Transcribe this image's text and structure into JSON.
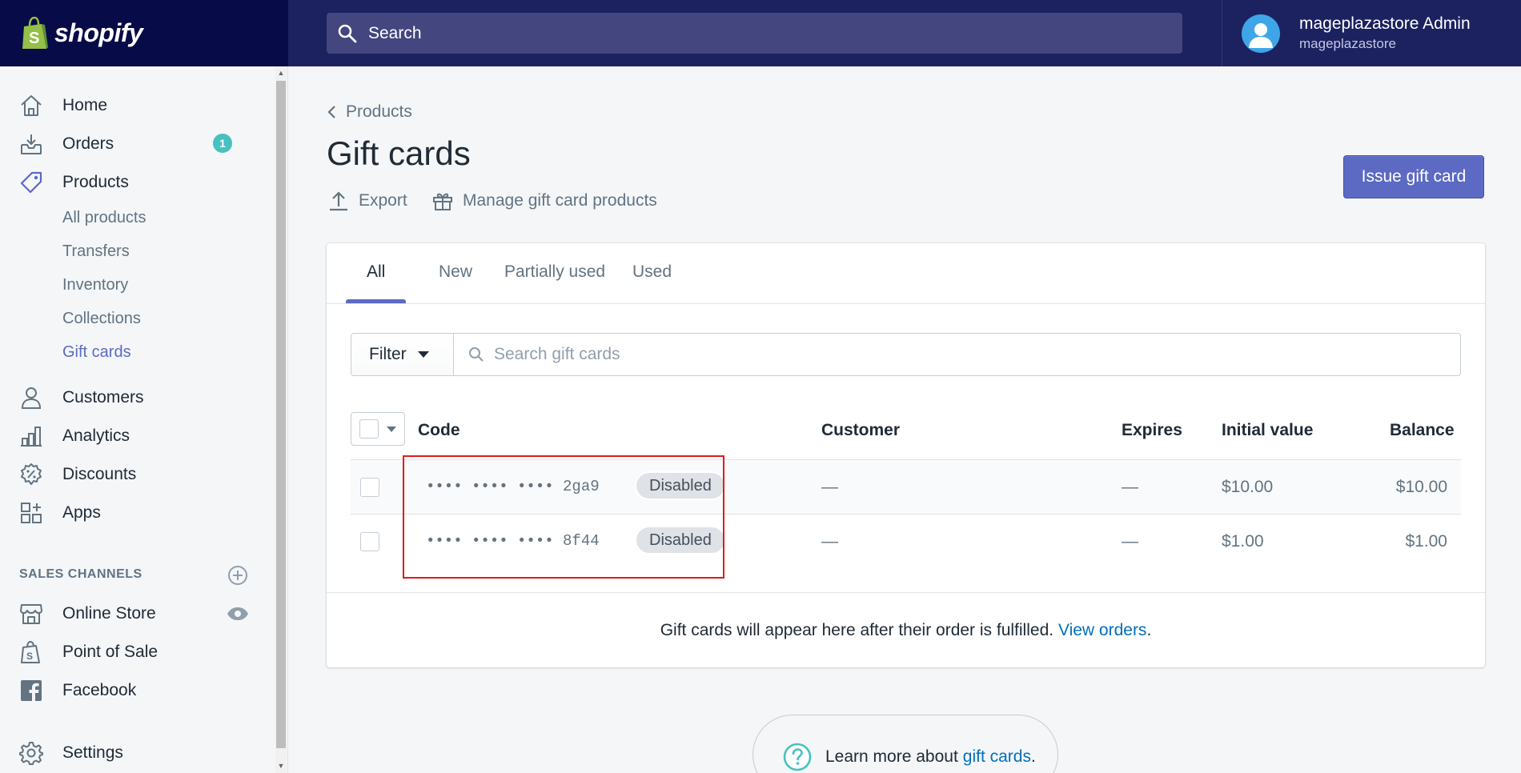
{
  "app": {
    "brand": "shopify",
    "accent": "#5c6ac4",
    "topbar_color": "#1c2260"
  },
  "search": {
    "placeholder": "Search"
  },
  "user": {
    "name": "mageplazastore Admin",
    "store": "mageplazastore"
  },
  "sidebar": {
    "items": [
      {
        "label": "Home",
        "icon": "home-icon"
      },
      {
        "label": "Orders",
        "icon": "orders-icon",
        "badge": "1"
      },
      {
        "label": "Products",
        "icon": "tag-icon"
      },
      {
        "label": "Customers",
        "icon": "person-icon"
      },
      {
        "label": "Analytics",
        "icon": "bar-chart-icon"
      },
      {
        "label": "Discounts",
        "icon": "discount-icon"
      },
      {
        "label": "Apps",
        "icon": "apps-icon"
      }
    ],
    "product_subitems": [
      "All products",
      "Transfers",
      "Inventory",
      "Collections",
      "Gift cards"
    ],
    "active_subitem": "Gift cards",
    "sales_channels_label": "SALES CHANNELS",
    "channels": [
      {
        "label": "Online Store",
        "icon": "store-icon"
      },
      {
        "label": "Point of Sale",
        "icon": "pos-icon"
      },
      {
        "label": "Facebook",
        "icon": "facebook-icon"
      }
    ],
    "settings_label": "Settings"
  },
  "page": {
    "breadcrumb": "Products",
    "title": "Gift cards",
    "actions": {
      "export": "Export",
      "manage": "Manage gift card products"
    },
    "primary_button": "Issue gift card"
  },
  "tabs": [
    "All",
    "New",
    "Partially used",
    "Used"
  ],
  "filter": {
    "button": "Filter",
    "search_placeholder": "Search gift cards"
  },
  "table": {
    "columns": [
      "Code",
      "Customer",
      "Expires",
      "Initial value",
      "Balance"
    ],
    "rows": [
      {
        "code": "•••• •••• •••• 2ga9",
        "status": "Disabled",
        "customer": "—",
        "expires": "—",
        "initial": "$10.00",
        "balance": "$10.00"
      },
      {
        "code": "•••• •••• •••• 8f44",
        "status": "Disabled",
        "customer": "—",
        "expires": "—",
        "initial": "$1.00",
        "balance": "$1.00"
      }
    ]
  },
  "footer": {
    "text": "Gift cards will appear here after their order is fulfilled.",
    "link": "View orders",
    "suffix": "."
  },
  "learn": {
    "prefix": "Learn more about",
    "link": "gift cards",
    "suffix": "."
  }
}
